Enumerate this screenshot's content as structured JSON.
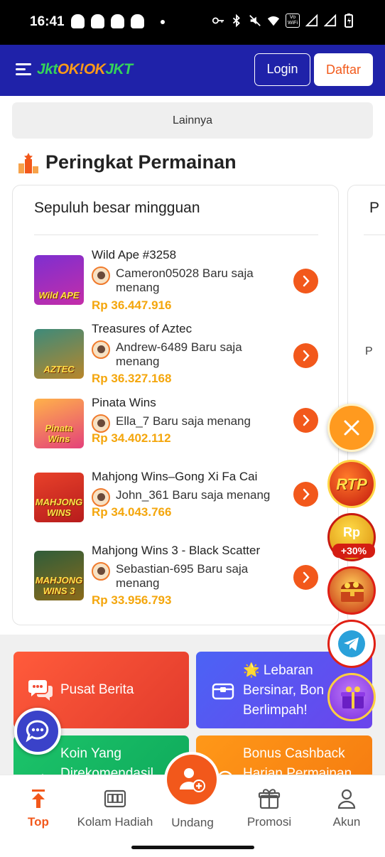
{
  "status_bar": {
    "time": "16:41",
    "icons": [
      "snapchat-icon",
      "snapchat-icon",
      "snapchat-icon",
      "snapchat-icon",
      "dot",
      "vpn-key-icon",
      "bluetooth-icon",
      "mute-icon",
      "wifi-icon",
      "vowifi-icon",
      "signal-icon",
      "signal-icon",
      "battery-icon"
    ],
    "vowifi_line1": "Vo",
    "vowifi_line2": "WiFi"
  },
  "header": {
    "logo_part1": "Jkt",
    "logo_part2": "OK",
    "logo_part3": "!OK",
    "logo_part4": "JKT",
    "login_label": "Login",
    "daftar_label": "Daftar",
    "brand_color": "#1f22a9",
    "accent_color": "#f2581b"
  },
  "lainnya_label": "Lainnya",
  "ranking": {
    "title": "Peringkat Permainan",
    "card_title": "Sepuluh besar mingguan",
    "second_card_title": "P",
    "second_card_peek": "P",
    "items": [
      {
        "game": "Wild Ape #3258",
        "thumb_text": "Wild APE",
        "winner": "Cameron05028 Baru saja menang",
        "prize": "Rp 36.447.916"
      },
      {
        "game": "Treasures of Aztec",
        "thumb_text": "AZTEC",
        "winner": "Andrew-6489 Baru saja menang",
        "prize": "Rp 36.327.168"
      },
      {
        "game": "Pinata Wins",
        "thumb_text": "Pinata Wins",
        "winner": "Ella_7 Baru saja menang",
        "prize": "Rp 34.402.112"
      },
      {
        "game": "Mahjong Wins–Gong Xi Fa Cai",
        "thumb_text": "MAHJONG WINS",
        "winner": "John_361 Baru saja menang",
        "prize": "Rp 34.043.766"
      },
      {
        "game": "Mahjong Wins 3 - Black Scatter",
        "thumb_text": "MAHJONG WINS 3",
        "winner": "Sebastian-695 Baru saja menang",
        "prize": "Rp 33.956.793"
      }
    ]
  },
  "tiles": {
    "berita": "Pusat Berita",
    "lebaran_line1": "🌟 Lebaran",
    "lebaran_line2": "Bersinar, Bon",
    "lebaran_line3": "Berlimpah!",
    "koin_line1": "Koin Yang",
    "koin_line2": "Direkomendasil",
    "bonus_line1": "Bonus Cashback",
    "bonus_line2": "Harian Permainan"
  },
  "floating": {
    "rtp": "RTP",
    "rp": "Rp",
    "rp_bonus": "+30%"
  },
  "bottom_nav": {
    "top": "Top",
    "kolam": "Kolam Hadiah",
    "undang": "Undang",
    "promosi": "Promosi",
    "akun": "Akun"
  }
}
